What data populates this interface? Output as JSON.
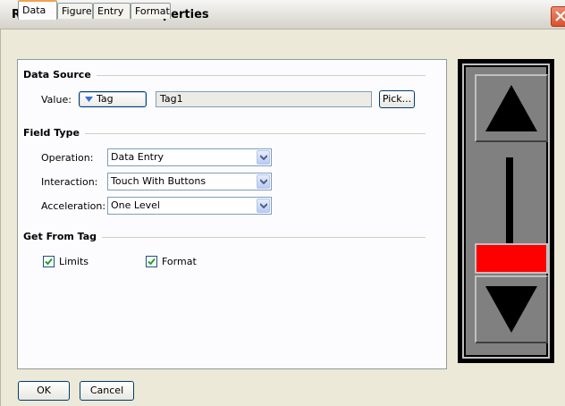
{
  "window": {
    "title": "Rich Vertical Slider Properties"
  },
  "tabs": [
    {
      "label": "Data",
      "active": true
    },
    {
      "label": "Figure",
      "active": false
    },
    {
      "label": "Entry",
      "active": false
    },
    {
      "label": "Format",
      "active": false
    }
  ],
  "data_source": {
    "section_title": "Data Source",
    "value_label": "Value:",
    "tag_button_label": "Tag",
    "value": "Tag1",
    "pick_label": "Pick..."
  },
  "field_type": {
    "section_title": "Field Type",
    "operation_label": "Operation:",
    "operation_value": "Data Entry",
    "interaction_label": "Interaction:",
    "interaction_value": "Touch With Buttons",
    "acceleration_label": "Acceleration:",
    "acceleration_value": "One Level"
  },
  "get_from_tag": {
    "section_title": "Get From Tag",
    "limits_label": "Limits",
    "limits_checked": true,
    "format_label": "Format",
    "format_checked": true
  },
  "buttons": {
    "ok": "OK",
    "cancel": "Cancel"
  },
  "preview": {
    "thumb_color": "#ff0000",
    "background_color": "#808080"
  },
  "icons": {
    "close": "close-icon",
    "tag_dropdown": "triangle-down-icon",
    "combo_arrow": "chevron-down-icon",
    "check": "checkmark-icon",
    "slider_up": "up-arrow-icon",
    "slider_down": "down-arrow-icon"
  }
}
